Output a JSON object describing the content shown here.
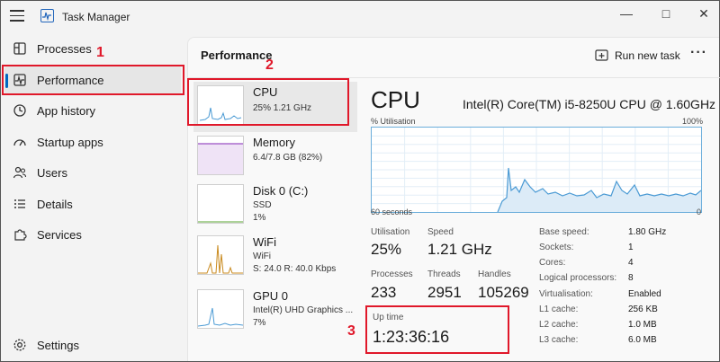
{
  "window": {
    "title": "Task Manager"
  },
  "sidebar": {
    "items": [
      {
        "label": "Processes",
        "icon": "grid-icon"
      },
      {
        "label": "Performance",
        "icon": "pulse-icon"
      },
      {
        "label": "App history",
        "icon": "history-icon"
      },
      {
        "label": "Startup apps",
        "icon": "speedometer-icon"
      },
      {
        "label": "Users",
        "icon": "users-icon"
      },
      {
        "label": "Details",
        "icon": "list-icon"
      },
      {
        "label": "Services",
        "icon": "puzzle-icon"
      }
    ],
    "settings_label": "Settings",
    "active_index": 1
  },
  "annotations": {
    "one": "1",
    "two": "2",
    "three": "3"
  },
  "main": {
    "title": "Performance",
    "run_task_label": "Run new task",
    "more_label": "···"
  },
  "devices": [
    {
      "name": "CPU",
      "sub1": "25%  1.21 GHz",
      "sub2": ""
    },
    {
      "name": "Memory",
      "sub1": "6.4/7.8 GB (82%)",
      "sub2": ""
    },
    {
      "name": "Disk 0 (C:)",
      "sub1": "SSD",
      "sub2": "1%"
    },
    {
      "name": "WiFi",
      "sub1": "WiFi",
      "sub2": "S: 24.0  R: 40.0 Kbps"
    },
    {
      "name": "GPU 0",
      "sub1": "Intel(R) UHD Graphics ...",
      "sub2": "7%"
    }
  ],
  "detail": {
    "title": "CPU",
    "model": "Intel(R) Core(TM) i5-8250U CPU @ 1.60GHz",
    "graph_label_left": "% Utilisation",
    "graph_label_right": "100%",
    "graph_time_left": "60 seconds",
    "graph_time_right": "0",
    "utilisation_label": "Utilisation",
    "utilisation_value": "25%",
    "speed_label": "Speed",
    "speed_value": "1.21 GHz",
    "processes_label": "Processes",
    "processes_value": "233",
    "threads_label": "Threads",
    "threads_value": "2951",
    "handles_label": "Handles",
    "handles_value": "105269",
    "uptime_label": "Up time",
    "uptime_value": "1:23:36:16",
    "specs": [
      {
        "k": "Base speed:",
        "v": "1.80 GHz"
      },
      {
        "k": "Sockets:",
        "v": "1"
      },
      {
        "k": "Cores:",
        "v": "4"
      },
      {
        "k": "Logical processors:",
        "v": "8"
      },
      {
        "k": "Virtualisation:",
        "v": "Enabled"
      },
      {
        "k": "L1 cache:",
        "v": "256 KB"
      },
      {
        "k": "L2 cache:",
        "v": "1.0 MB"
      },
      {
        "k": "L3 cache:",
        "v": "6.0 MB"
      }
    ]
  },
  "colors": {
    "accent": "#0067c0",
    "annotation": "#e0182a",
    "graph_line": "#4a9ad4",
    "memory_line": "#9b4fc4",
    "wifi_line": "#c98a1e"
  }
}
